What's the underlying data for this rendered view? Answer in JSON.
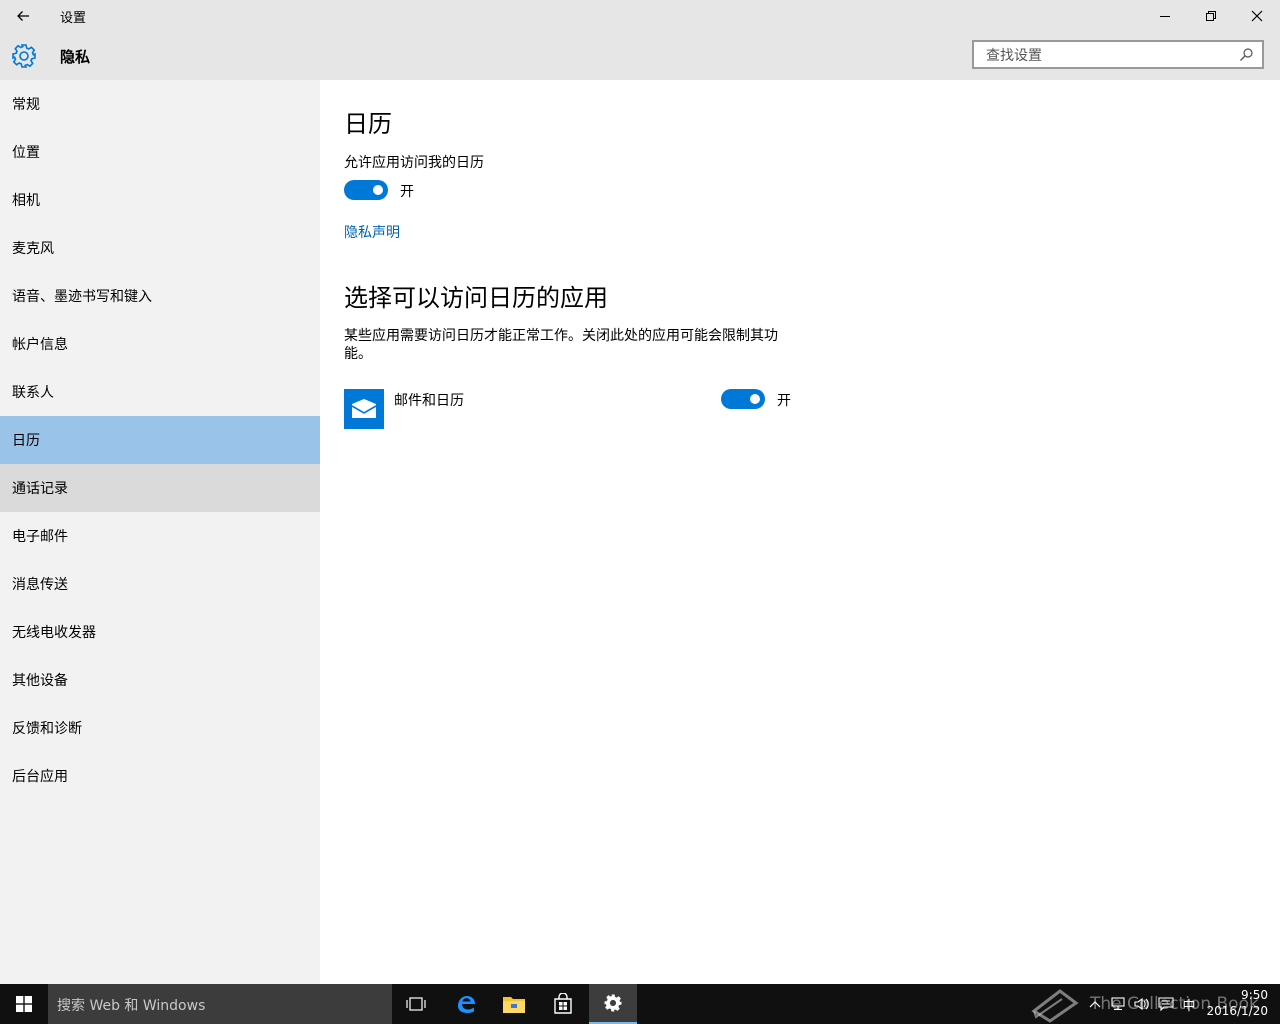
{
  "window": {
    "title": "设置",
    "page_header": "隐私",
    "search_placeholder": "查找设置"
  },
  "sidebar": {
    "items": [
      {
        "label": "常规"
      },
      {
        "label": "位置"
      },
      {
        "label": "相机"
      },
      {
        "label": "麦克风"
      },
      {
        "label": "语音、墨迹书写和键入"
      },
      {
        "label": "帐户信息"
      },
      {
        "label": "联系人"
      },
      {
        "label": "日历",
        "state": "selected"
      },
      {
        "label": "通话记录",
        "state": "hover"
      },
      {
        "label": "电子邮件"
      },
      {
        "label": "消息传送"
      },
      {
        "label": "无线电收发器"
      },
      {
        "label": "其他设备"
      },
      {
        "label": "反馈和诊断"
      },
      {
        "label": "后台应用"
      }
    ]
  },
  "content": {
    "heading": "日历",
    "allow_label": "允许应用访问我的日历",
    "allow_toggle_state": "开",
    "privacy_link": "隐私声明",
    "section_heading": "选择可以访问日历的应用",
    "section_desc": "某些应用需要访问日历才能正常工作。关闭此处的应用可能会限制其功能。",
    "apps": [
      {
        "name": "邮件和日历",
        "toggle_state": "开",
        "icon": "mail-calendar-icon"
      }
    ]
  },
  "taskbar": {
    "search_placeholder": "搜索 Web 和 Windows",
    "watermark": "The Collection Book",
    "ime": "中",
    "time": "9:50",
    "date": "2016/1/20"
  },
  "colors": {
    "accent": "#0078d7",
    "selected_nav": "#99c3e8",
    "link": "#0063b1"
  }
}
